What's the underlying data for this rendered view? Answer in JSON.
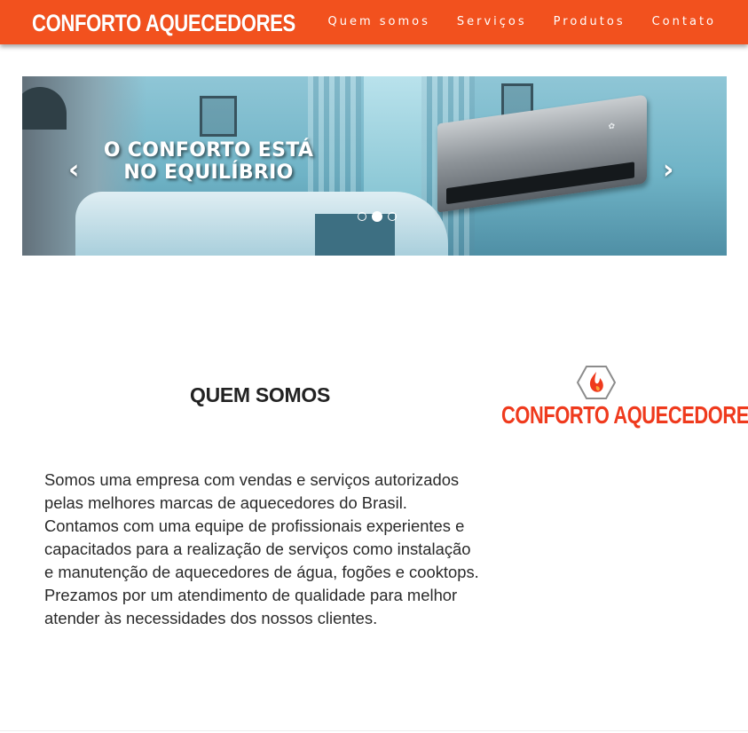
{
  "header": {
    "brand": "CONFORTO AQUECEDORES",
    "nav": [
      "Quem somos",
      "Serviços",
      "Produtos",
      "Contato"
    ],
    "background_color": "#f2511e"
  },
  "carousel": {
    "caption_line1": "O CONFORTO ESTÁ",
    "caption_line2": "NO EQUILÍBRIO",
    "prev_icon": "‹",
    "next_icon": "›",
    "indicator_count": 3,
    "active_indicator": 2
  },
  "about": {
    "title": "QUEM SOMOS",
    "text": "Somos uma empresa com vendas e serviços autorizados pelas melhores marcas de aquecedores do Brasil. Contamos com uma equipe de profissionais experientes e capacitados para a realização de serviços como instalação e manutenção de aquecedores de água, fogões e cooktops. Prezamos por um atendimento de qualidade para melhor atender às necessidades dos nossos clientes.",
    "logo_text": "CONFORTO AQUECEDORES",
    "logo_color": "#ef3a1d"
  }
}
